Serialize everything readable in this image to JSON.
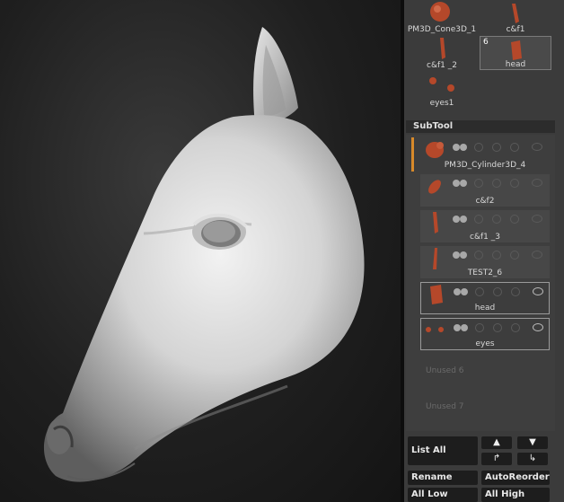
{
  "tool_thumbnails": [
    {
      "label": "PM3D_Cone3D_1"
    },
    {
      "label": "c&f1"
    },
    {
      "label": "c&f1 _2"
    },
    {
      "label": "head",
      "badge": "6",
      "selected": true
    },
    {
      "label": "eyes1"
    }
  ],
  "subtool": {
    "title": "SubTool",
    "items": [
      {
        "name": "PM3D_Cylinder3D_4",
        "active": true
      },
      {
        "name": "c&f2"
      },
      {
        "name": "c&f1 _3"
      },
      {
        "name": "TEST2_6"
      },
      {
        "name": "head",
        "selected": true
      },
      {
        "name": "eyes",
        "selected": true
      }
    ],
    "unused": [
      "Unused 6",
      "Unused 7"
    ]
  },
  "buttons": {
    "list_all": "List All",
    "rename": "Rename",
    "auto_reorder": "AutoReorder",
    "all_low": "All Low",
    "all_high": "All High",
    "arrow_up": "▲",
    "arrow_down": "▼",
    "move_in": "↱",
    "move_out": "↳"
  },
  "colors": {
    "accent": "#d88a2a",
    "panel": "#3b3b3b",
    "model": "#c8c8c8",
    "subtool_thumb": "#b5482a"
  }
}
